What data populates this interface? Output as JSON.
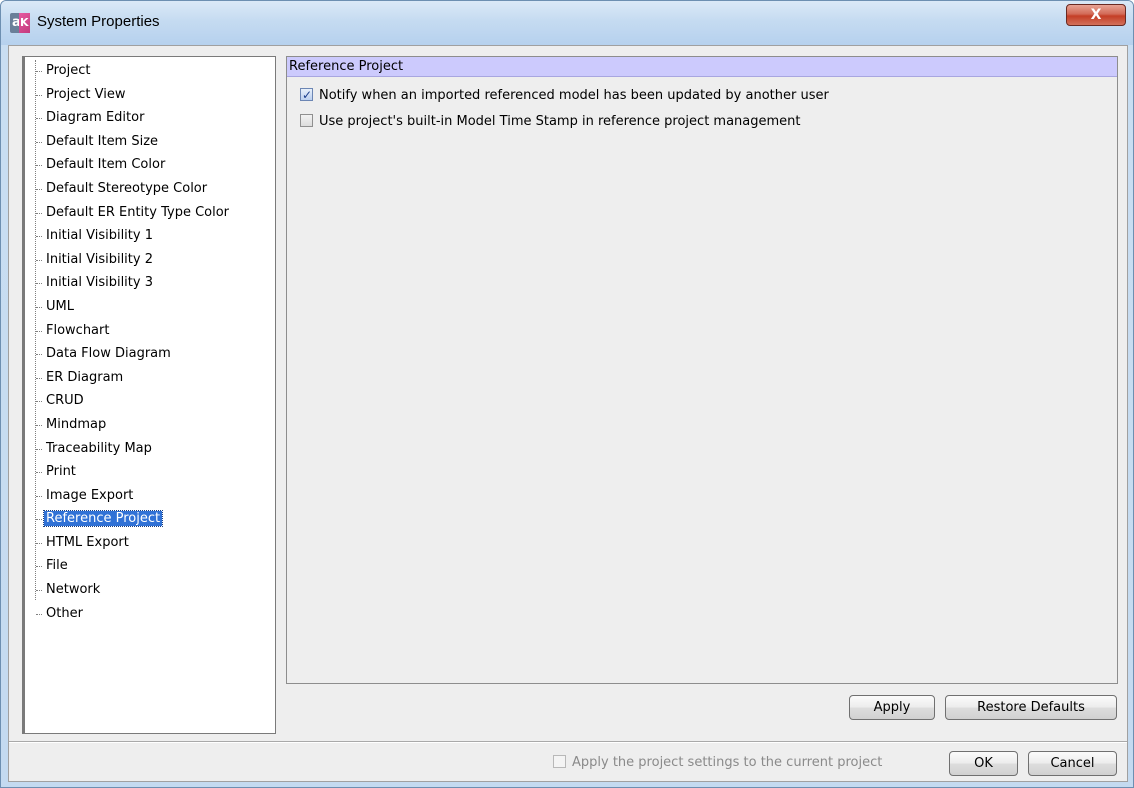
{
  "window": {
    "title": "System Properties",
    "close_symbol": "X"
  },
  "logo": {
    "left_letter": "a",
    "right_letter": "K"
  },
  "tree": {
    "items": [
      "Project",
      "Project View",
      "Diagram Editor",
      "Default Item Size",
      "Default Item Color",
      "Default Stereotype Color",
      "Default ER Entity Type Color",
      "Initial Visibility 1",
      "Initial Visibility 2",
      "Initial Visibility 3",
      "UML",
      "Flowchart",
      "Data Flow Diagram",
      "ER Diagram",
      "CRUD",
      "Mindmap",
      "Traceability Map",
      "Print",
      "Image Export",
      "Reference Project",
      "HTML Export",
      "File",
      "Network",
      "Other"
    ],
    "selected": "Reference Project"
  },
  "panel": {
    "header": "Reference Project",
    "options": [
      {
        "label": "Notify when an imported referenced model has been updated by another user",
        "checked": true
      },
      {
        "label": "Use project's built-in Model Time Stamp in reference project management",
        "checked": false
      }
    ],
    "apply_label": "Apply",
    "restore_label": "Restore Defaults"
  },
  "footer": {
    "apply_project_label": "Apply the project settings to the current project",
    "apply_project_checked": false,
    "apply_project_enabled": false,
    "ok_label": "OK",
    "cancel_label": "Cancel"
  },
  "colors": {
    "selection": "#3172d6",
    "panel_header": "#cccafd",
    "close_button": "#c43e26"
  }
}
